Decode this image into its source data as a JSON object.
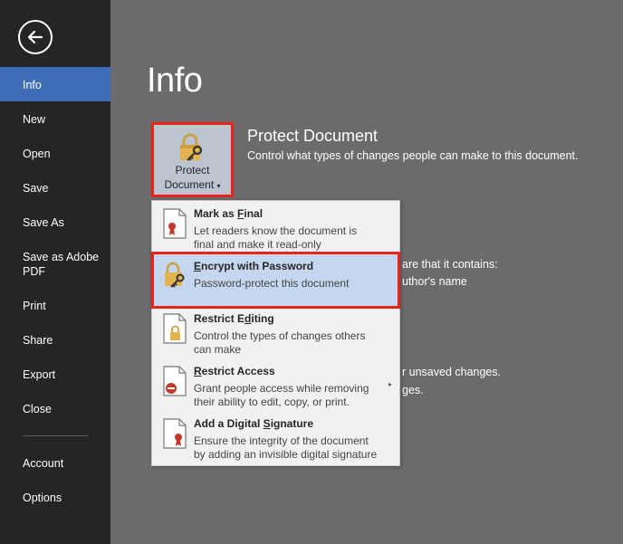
{
  "sidebar": {
    "items": [
      {
        "label": "Info"
      },
      {
        "label": "New"
      },
      {
        "label": "Open"
      },
      {
        "label": "Save"
      },
      {
        "label": "Save As"
      },
      {
        "label": "Save as Adobe"
      },
      {
        "label": "PDF"
      },
      {
        "label": "Print"
      },
      {
        "label": "Share"
      },
      {
        "label": "Export"
      },
      {
        "label": "Close"
      },
      {
        "label": "Account"
      },
      {
        "label": "Options"
      }
    ]
  },
  "main": {
    "title": "Info",
    "protect": {
      "button_line1": "Protect",
      "button_line2": "Document",
      "dropdown_glyph": "▾",
      "title": "Protect Document",
      "description": "Control what types of changes people can make to this document."
    },
    "background_text": {
      "line1": "are that it contains:",
      "line2": "uthor's name",
      "line3": "r unsaved changes.",
      "line4": "ges."
    }
  },
  "menu": {
    "items": [
      {
        "title_pre": "Mark as ",
        "title_u": "F",
        "title_post": "inal",
        "desc1": "Let readers know the document is",
        "desc2": "final and make it read-only",
        "icon": "document-ribbon-icon"
      },
      {
        "title_pre": "",
        "title_u": "E",
        "title_post": "ncrypt with Password",
        "desc1": "Password-protect this document",
        "desc2": "",
        "icon": "lock-key-icon"
      },
      {
        "title_pre": "Restrict E",
        "title_u": "d",
        "title_post": "iting",
        "desc1": "Control the types of changes others",
        "desc2": "can make",
        "icon": "document-lock-icon"
      },
      {
        "title_pre": "",
        "title_u": "R",
        "title_post": "estrict Access",
        "desc1": "Grant people access while removing",
        "desc2": "their ability to edit, copy, or print.",
        "icon": "document-restricted-icon"
      },
      {
        "title_pre": "Add a Digital ",
        "title_u": "S",
        "title_post": "ignature",
        "desc1": "Ensure the integrity of the document",
        "desc2": "by adding an invisible digital signature",
        "icon": "document-signature-icon"
      }
    ],
    "submenu_glyph": "▸"
  },
  "colors": {
    "sidebar_bg": "#252525",
    "active": "#3e6db5",
    "main_bg": "#6b6b6b",
    "highlight_border": "#e8241a",
    "menu_highlight": "#c5d7f0"
  }
}
